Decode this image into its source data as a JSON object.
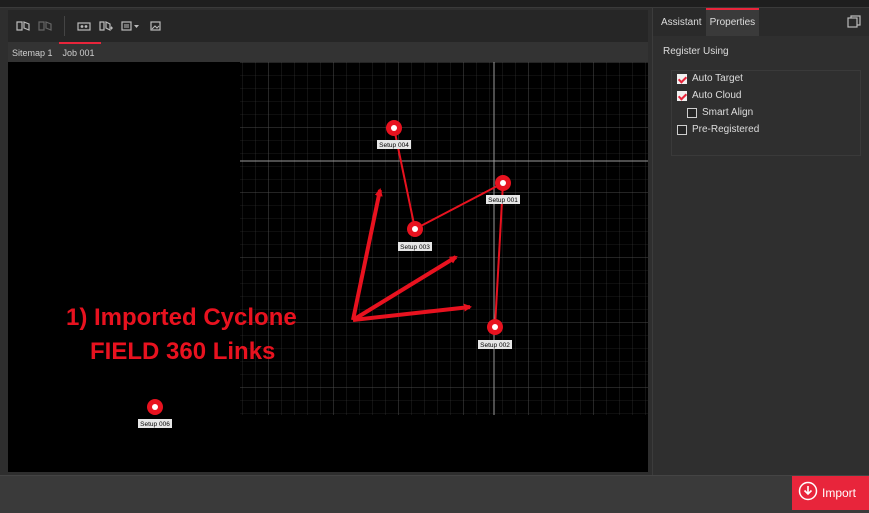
{
  "toolbar": {
    "icons": [
      "sitemap-icon",
      "sitemap-disabled-icon",
      "station-icon",
      "sitemap-add-icon",
      "view-dropdown-icon",
      "image-icon"
    ]
  },
  "tabs": [
    {
      "label": "Sitemap 1"
    },
    {
      "label": "Job 001"
    }
  ],
  "setups": [
    {
      "label": "Setup 004"
    },
    {
      "label": "Setup 001"
    },
    {
      "label": "Setup 003"
    },
    {
      "label": "Setup 002"
    },
    {
      "label": "Setup 006"
    }
  ],
  "annotation": {
    "line1": "1) Imported Cyclone",
    "line2": "FIELD 360 Links"
  },
  "right_panel": {
    "tabs": [
      {
        "label": "Assistant"
      },
      {
        "label": "Properties"
      }
    ],
    "section_title": "Register Using",
    "options": [
      {
        "label": "Auto Target",
        "checked": true
      },
      {
        "label": "Auto Cloud",
        "checked": true
      },
      {
        "label": "Smart Align",
        "checked": false
      },
      {
        "label": "Pre-Registered",
        "checked": false
      }
    ]
  },
  "import_button": {
    "label": "Import"
  },
  "colors": {
    "accent": "#e8253b",
    "annotation": "#e8121f",
    "canvas": "#000000"
  }
}
